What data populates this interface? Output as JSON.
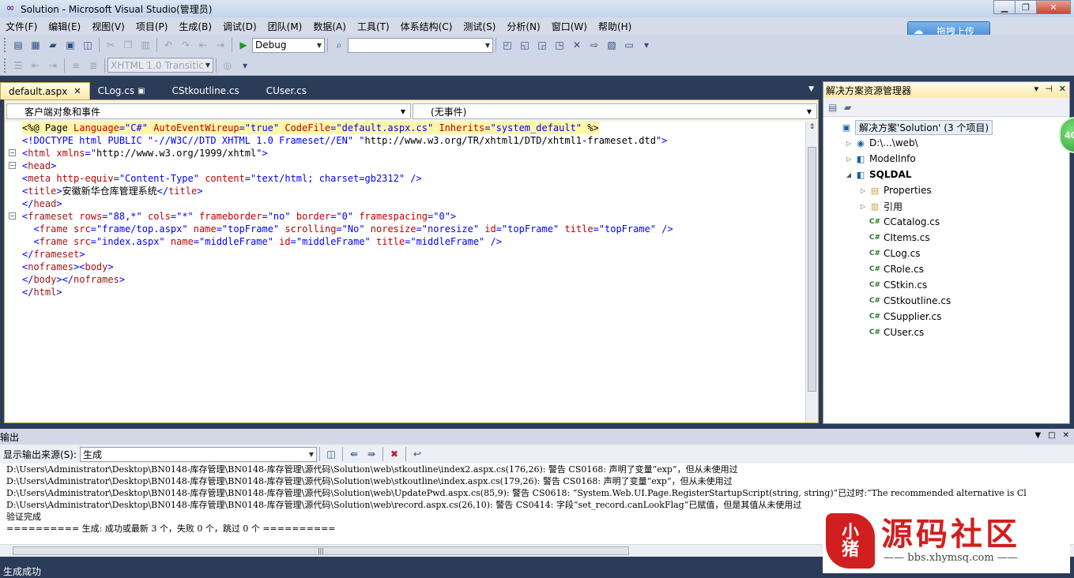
{
  "window": {
    "title": "Solution - Microsoft Visual Studio(管理员)",
    "logo": "∞",
    "buttons": {
      "minimize": "▁",
      "maximize": "❐",
      "close": "✕"
    }
  },
  "menu": [
    "文件(F)",
    "编辑(E)",
    "视图(V)",
    "项目(P)",
    "生成(B)",
    "调试(D)",
    "团队(M)",
    "数据(A)",
    "工具(T)",
    "体系结构(C)",
    "测试(S)",
    "分析(N)",
    "窗口(W)",
    "帮助(H)"
  ],
  "toolbar": {
    "config": "Debug",
    "platform": "",
    "doctype": "XHTML 1.0 Transitic",
    "upload_label": "拖拽上传",
    "upload_icon": "☁"
  },
  "tabs": [
    {
      "label": "default.aspx",
      "active": true
    },
    {
      "label": "CLog.cs"
    },
    {
      "label": "CStkoutline.cs"
    },
    {
      "label": "CUser.cs"
    }
  ],
  "editor": {
    "nav_left": "客户端对象和事件",
    "nav_right": "(无事件)",
    "code": [
      [
        [
          "<%@ Page ",
          "t-black"
        ],
        [
          "Language",
          "t-red"
        ],
        [
          "=\"C#\" ",
          "t-blue"
        ],
        [
          "AutoEventWireup",
          "t-red"
        ],
        [
          "=\"true\" ",
          "t-blue"
        ],
        [
          "CodeFile",
          "t-red"
        ],
        [
          "=\"default.aspx.cs\" ",
          "t-blue"
        ],
        [
          "Inherits",
          "t-red"
        ],
        [
          "=\"system_default\" ",
          "t-blue"
        ],
        [
          "%>",
          "t-black"
        ]
      ],
      [
        [
          "<!DOCTYPE html PUBLIC \"-//W3C//DTD XHTML 1.0 Frameset//EN\" \"",
          "t-blue"
        ],
        [
          "http://www.w3.org/TR/xhtml1/DTD/xhtml1-frameset.dtd",
          "t-black"
        ],
        [
          "\">",
          "t-blue"
        ]
      ],
      [
        [
          "<",
          "t-blue"
        ],
        [
          "html ",
          "t-maroon"
        ],
        [
          "xmlns",
          "t-red"
        ],
        [
          "=\"",
          "t-blue"
        ],
        [
          "http://www.w3.org/1999/xhtml",
          "t-black"
        ],
        [
          "\">",
          "t-blue"
        ]
      ],
      [
        [
          "<",
          "t-blue"
        ],
        [
          "head",
          "t-maroon"
        ],
        [
          ">",
          "t-blue"
        ]
      ],
      [
        [
          "<",
          "t-blue"
        ],
        [
          "meta ",
          "t-maroon"
        ],
        [
          "http-equiv",
          "t-red"
        ],
        [
          "=\"Content-Type\" ",
          "t-blue"
        ],
        [
          "content",
          "t-red"
        ],
        [
          "=\"text/html; charset=gb2312\" />",
          "t-blue"
        ]
      ],
      [
        [
          "<",
          "t-blue"
        ],
        [
          "title",
          "t-maroon"
        ],
        [
          ">",
          "t-blue"
        ],
        [
          "安徽新华仓库管理系统",
          "t-black"
        ],
        [
          "</",
          "t-blue"
        ],
        [
          "title",
          "t-maroon"
        ],
        [
          ">",
          "t-blue"
        ]
      ],
      [
        [
          "</",
          "t-blue"
        ],
        [
          "head",
          "t-maroon"
        ],
        [
          ">",
          "t-blue"
        ]
      ],
      [
        [
          "<",
          "t-blue"
        ],
        [
          "frameset ",
          "t-maroon"
        ],
        [
          "rows",
          "t-red"
        ],
        [
          "=\"88,*\" ",
          "t-blue"
        ],
        [
          "cols",
          "t-red"
        ],
        [
          "=\"*\" ",
          "t-blue"
        ],
        [
          "frameborder",
          "t-red"
        ],
        [
          "=\"no\" ",
          "t-blue"
        ],
        [
          "border",
          "t-red"
        ],
        [
          "=\"0\" ",
          "t-blue"
        ],
        [
          "framespacing",
          "t-red"
        ],
        [
          "=\"0\">",
          "t-blue"
        ]
      ],
      [
        [
          "  <",
          "t-blue"
        ],
        [
          "frame ",
          "t-maroon"
        ],
        [
          "src",
          "t-red"
        ],
        [
          "=\"frame/top.aspx\" ",
          "t-blue"
        ],
        [
          "name",
          "t-red"
        ],
        [
          "=\"topFrame\" ",
          "t-blue"
        ],
        [
          "scrolling",
          "t-red"
        ],
        [
          "=\"No\" ",
          "t-blue"
        ],
        [
          "noresize",
          "t-red"
        ],
        [
          "=\"noresize\" ",
          "t-blue"
        ],
        [
          "id",
          "t-red"
        ],
        [
          "=\"topFrame\" ",
          "t-blue"
        ],
        [
          "title",
          "t-red"
        ],
        [
          "=\"topFrame\" />",
          "t-blue"
        ]
      ],
      [
        [
          "  <",
          "t-blue"
        ],
        [
          "frame ",
          "t-maroon"
        ],
        [
          "src",
          "t-red"
        ],
        [
          "=\"index.aspx\" ",
          "t-blue"
        ],
        [
          "name",
          "t-red"
        ],
        [
          "=\"middleFrame\" ",
          "t-blue"
        ],
        [
          "id",
          "t-red"
        ],
        [
          "=\"middleFrame\" ",
          "t-blue"
        ],
        [
          "title",
          "t-red"
        ],
        [
          "=\"middleFrame\" />",
          "t-blue"
        ]
      ],
      [
        [
          "</",
          "t-blue"
        ],
        [
          "frameset",
          "t-maroon"
        ],
        [
          ">",
          "t-blue"
        ]
      ],
      [
        [
          "<",
          "t-blue"
        ],
        [
          "noframes",
          "t-maroon"
        ],
        [
          "><",
          "t-blue"
        ],
        [
          "body",
          "t-maroon"
        ],
        [
          ">",
          "t-blue"
        ]
      ],
      [
        [
          "</",
          "t-blue"
        ],
        [
          "body",
          "t-maroon"
        ],
        [
          "></",
          "t-blue"
        ],
        [
          "noframes",
          "t-maroon"
        ],
        [
          ">",
          "t-blue"
        ]
      ],
      [
        [
          "</",
          "t-blue"
        ],
        [
          "html",
          "t-maroon"
        ],
        [
          ">",
          "t-blue"
        ]
      ]
    ]
  },
  "solution_explorer": {
    "title": "解决方案资源管理器",
    "controls": [
      "▾",
      "⊣",
      "✕"
    ],
    "tree": [
      {
        "label": "解决方案'Solution' (3 个项目)",
        "depth": 0,
        "exp": "",
        "icon": "▣",
        "cls": "root"
      },
      {
        "label": "D:\\...\\web\\",
        "depth": 1,
        "exp": "▷",
        "icon": "◉",
        "cls": ""
      },
      {
        "label": "ModelInfo",
        "depth": 1,
        "exp": "▷",
        "icon": "◧",
        "cls": ""
      },
      {
        "label": "SQLDAL",
        "depth": 1,
        "exp": "◢",
        "icon": "◧",
        "cls": "bold"
      },
      {
        "label": "Properties",
        "depth": 2,
        "exp": "▷",
        "icon": "▤",
        "cls": ""
      },
      {
        "label": "引用",
        "depth": 2,
        "exp": "▷",
        "icon": "▥",
        "cls": ""
      },
      {
        "label": "CCatalog.cs",
        "depth": 2,
        "exp": "",
        "icon": "C#",
        "cls": ""
      },
      {
        "label": "CItems.cs",
        "depth": 2,
        "exp": "",
        "icon": "C#",
        "cls": ""
      },
      {
        "label": "CLog.cs",
        "depth": 2,
        "exp": "",
        "icon": "C#",
        "cls": ""
      },
      {
        "label": "CRole.cs",
        "depth": 2,
        "exp": "",
        "icon": "C#",
        "cls": ""
      },
      {
        "label": "CStkin.cs",
        "depth": 2,
        "exp": "",
        "icon": "C#",
        "cls": ""
      },
      {
        "label": "CStkoutline.cs",
        "depth": 2,
        "exp": "",
        "icon": "C#",
        "cls": ""
      },
      {
        "label": "CSupplier.cs",
        "depth": 2,
        "exp": "",
        "icon": "C#",
        "cls": ""
      },
      {
        "label": "CUser.cs",
        "depth": 2,
        "exp": "",
        "icon": "C#",
        "cls": ""
      }
    ]
  },
  "badge": "40",
  "output": {
    "title": "输出",
    "source_label": "显示输出来源(S):",
    "source_value": "生成",
    "lines": [
      "D:\\Users\\Administrator\\Desktop\\BN0148-库存管理\\BN0148-库存管理\\源代码\\Solution\\web\\stkoutline\\index2.aspx.cs(176,26): 警告 CS0168: 声明了变量“exp”，但从未使用过",
      "D:\\Users\\Administrator\\Desktop\\BN0148-库存管理\\BN0148-库存管理\\源代码\\Solution\\web\\stkoutline\\index.aspx.cs(179,26): 警告 CS0168: 声明了变量“exp”，但从未使用过",
      "D:\\Users\\Administrator\\Desktop\\BN0148-库存管理\\BN0148-库存管理\\源代码\\Solution\\web\\UpdatePwd.aspx.cs(85,9): 警告 CS0618: “System.Web.UI.Page.RegisterStartupScript(string, string)”已过时:“The recommended alternative is Cl",
      "D:\\Users\\Administrator\\Desktop\\BN0148-库存管理\\BN0148-库存管理\\源代码\\Solution\\web\\record.aspx.cs(26,10): 警告 CS0414: 字段“set_record.canLookFlag”已赋值，但是其值从未使用过",
      "验证完成",
      "========== 生成: 成功或最新 3 个，失败 0 个，跳过 0 个 =========="
    ],
    "hscroll_grip": "|||"
  },
  "status": "生成成功",
  "watermark": {
    "seal": "小\n猪",
    "title": "源码社区",
    "url": "—— bbs.xhymsq.com ——"
  }
}
